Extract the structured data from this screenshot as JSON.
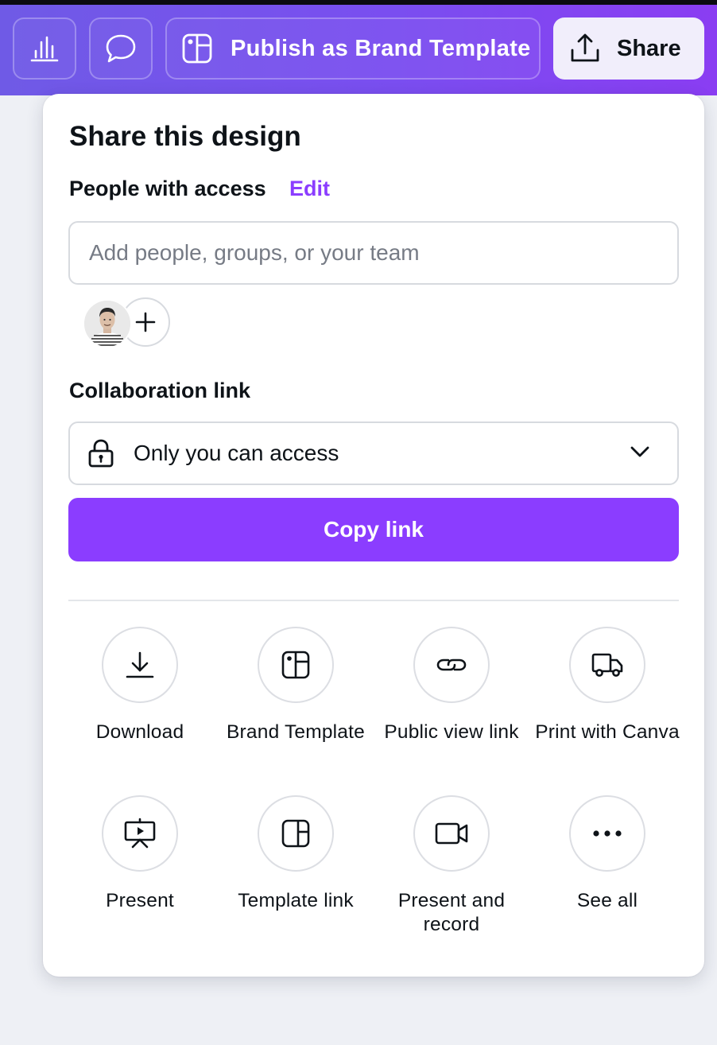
{
  "toolbar": {
    "publish_label": "Publish as Brand Template",
    "share_label": "Share"
  },
  "panel": {
    "title": "Share this design",
    "people_label": "People with access",
    "edit_label": "Edit",
    "add_people_placeholder": "Add people, groups, or your team",
    "collab_label": "Collaboration link",
    "access_value": "Only you can access",
    "copy_link_label": "Copy link"
  },
  "options": [
    {
      "label": "Download",
      "icon": "download-icon"
    },
    {
      "label": "Brand Template",
      "icon": "brand-template-icon"
    },
    {
      "label": "Public view link",
      "icon": "link-icon"
    },
    {
      "label": "Print with Canva",
      "icon": "truck-icon"
    },
    {
      "label": "Present",
      "icon": "present-icon"
    },
    {
      "label": "Template link",
      "icon": "template-link-icon"
    },
    {
      "label": "Present and record",
      "icon": "video-camera-icon"
    },
    {
      "label": "See all",
      "icon": "more-icon"
    }
  ],
  "colors": {
    "accent": "#8b3dff",
    "toolbar_gradient_start": "#6f5ae6",
    "toolbar_gradient_end": "#8a3df2"
  }
}
